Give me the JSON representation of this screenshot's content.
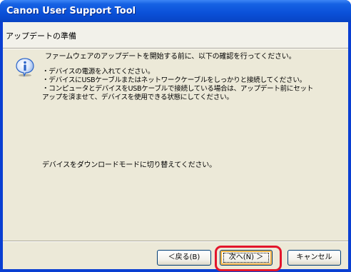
{
  "window": {
    "title": "Canon User Support Tool"
  },
  "header": {
    "title": "アップデートの準備"
  },
  "body": {
    "intro": "ファームウェアのアップデートを開始する前に、以下の確認を行ってください。",
    "bullets": [
      "・デバイスの電源を入れてください。",
      "・デバイスにUSBケーブルまたはネットワークケーブルをしっかりと接続してください。",
      "・コンピュータとデバイスをUSBケーブルで接続している場合は、アップデート前にセット",
      "アップを済ませて、デバイスを使用できる状態にしてください。"
    ],
    "download_instruction": "デバイスをダウンロードモードに切り替えてください。"
  },
  "buttons": {
    "back_label": "＜戻る(B)",
    "next_label": "次へ(N) ＞",
    "cancel_label": "キャンセル"
  },
  "icons": {
    "info": "info-icon"
  },
  "colors": {
    "titlebar": "#0a50d8",
    "dialog_bg": "#ece9d8",
    "highlight": "#e3152b",
    "info_icon": "#2b64c8"
  }
}
